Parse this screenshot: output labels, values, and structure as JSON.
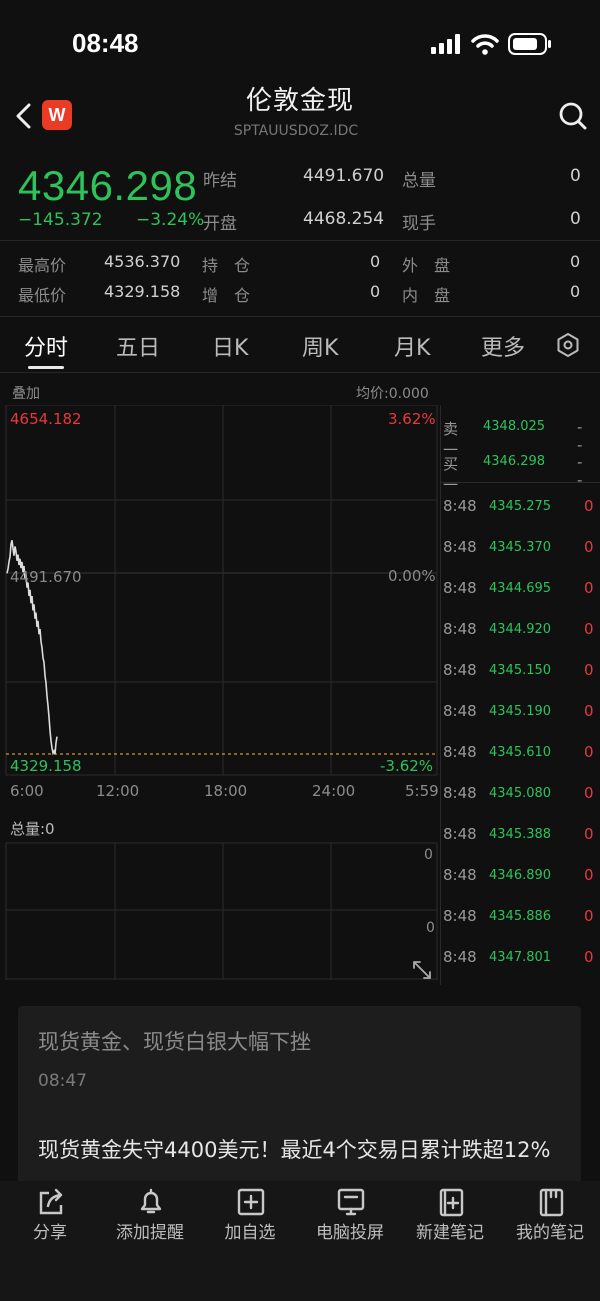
{
  "status_bar": {
    "time": "08:48"
  },
  "header": {
    "logo": "W",
    "title": "伦敦金现",
    "code": "SPTAUUSDOZ.IDC"
  },
  "quote": {
    "price": "4346.298",
    "change": "−145.372",
    "change_pct": "−3.24%",
    "prev_close_label": "昨结",
    "prev_close": "4491.670",
    "total_vol_label": "总量",
    "total_vol": "0",
    "open_label": "开盘",
    "open": "4468.254",
    "current_hand_label": "现手",
    "current_hand": "0",
    "high_label": "最高价",
    "high": "4536.370",
    "low_label": "最低价",
    "low": "4329.158",
    "position_label": "持　仓",
    "position": "0",
    "increase_label": "增　仓",
    "increase": "0",
    "outer_label": "外　盘",
    "outer": "0",
    "inner_label": "内　盘",
    "inner": "0"
  },
  "tabs": [
    "分时",
    "五日",
    "日K",
    "周K",
    "月K",
    "更多"
  ],
  "chart": {
    "overlay_label": "叠加",
    "avg_label": "均价:0.000",
    "top_price": "4654.182",
    "top_pct": "3.62%",
    "mid_price": "4491.670",
    "mid_pct": "0.00%",
    "bottom_price": "4329.158",
    "bottom_pct": "-3.62%",
    "x_ticks": [
      "6:00",
      "12:00",
      "18:00",
      "24:00",
      "5:59"
    ],
    "volume_label": "总量:0",
    "vol_top": "0",
    "vol_mid": "0"
  },
  "chart_data": {
    "type": "line",
    "x": [
      0,
      1,
      2,
      3,
      4,
      5,
      6,
      7,
      8,
      9,
      10,
      11,
      12,
      13,
      14,
      15,
      16,
      17,
      18,
      19,
      20,
      21,
      22,
      23,
      24,
      25,
      26,
      27,
      28,
      29,
      30,
      31,
      32,
      33,
      34,
      35,
      36,
      37,
      38,
      39,
      40,
      41,
      42,
      43,
      44,
      45,
      46,
      47,
      48,
      49,
      50
    ],
    "y": [
      4504,
      4508,
      4515,
      4520,
      4532,
      4536,
      4528,
      4521,
      4530,
      4525,
      4516,
      4522,
      4512,
      4518,
      4509,
      4515,
      4505,
      4511,
      4498,
      4503,
      4490,
      4495,
      4482,
      4488,
      4475,
      4482,
      4468,
      4474,
      4460,
      4466,
      4452,
      4458,
      4445,
      4450,
      4438,
      4432,
      4422,
      4418,
      4405,
      4398,
      4385,
      4376,
      4365,
      4352,
      4342,
      4335,
      4330,
      4332,
      4329,
      4340,
      4346
    ],
    "ylim": [
      4329.158,
      4654.182
    ],
    "reference": 4491.67,
    "x_ticks": [
      "6:00",
      "12:00",
      "18:00",
      "24:00",
      "5:59"
    ]
  },
  "order_book": [
    {
      "label": "卖一",
      "price": "4348.025",
      "vol": "--"
    },
    {
      "label": "买一",
      "price": "4346.298",
      "vol": "--"
    }
  ],
  "ticks": [
    {
      "time": "8:48",
      "price": "4345.275",
      "vol": "0"
    },
    {
      "time": "8:48",
      "price": "4345.370",
      "vol": "0"
    },
    {
      "time": "8:48",
      "price": "4344.695",
      "vol": "0"
    },
    {
      "time": "8:48",
      "price": "4344.920",
      "vol": "0"
    },
    {
      "time": "8:48",
      "price": "4345.150",
      "vol": "0"
    },
    {
      "time": "8:48",
      "price": "4345.190",
      "vol": "0"
    },
    {
      "time": "8:48",
      "price": "4345.610",
      "vol": "0"
    },
    {
      "time": "8:48",
      "price": "4345.080",
      "vol": "0"
    },
    {
      "time": "8:48",
      "price": "4345.388",
      "vol": "0"
    },
    {
      "time": "8:48",
      "price": "4346.890",
      "vol": "0"
    },
    {
      "time": "8:48",
      "price": "4345.886",
      "vol": "0"
    },
    {
      "time": "8:48",
      "price": "4347.801",
      "vol": "0"
    }
  ],
  "news": {
    "item1_title": "现货黄金、现货白银大幅下挫",
    "item1_time": "08:47",
    "item2_title": "现货黄金失守4400美元！最近4个交易日累计跌超12%"
  },
  "bottom_bar": [
    {
      "label": "分享",
      "icon": "share-icon"
    },
    {
      "label": "添加提醒",
      "icon": "bell-icon"
    },
    {
      "label": "加自选",
      "icon": "add-watchlist-icon"
    },
    {
      "label": "电脑投屏",
      "icon": "screen-cast-icon"
    },
    {
      "label": "新建笔记",
      "icon": "new-note-icon"
    },
    {
      "label": "我的笔记",
      "icon": "notebook-icon"
    }
  ],
  "colors": {
    "up": "#e8393a",
    "down": "#2ec25b",
    "background": "#101010"
  }
}
